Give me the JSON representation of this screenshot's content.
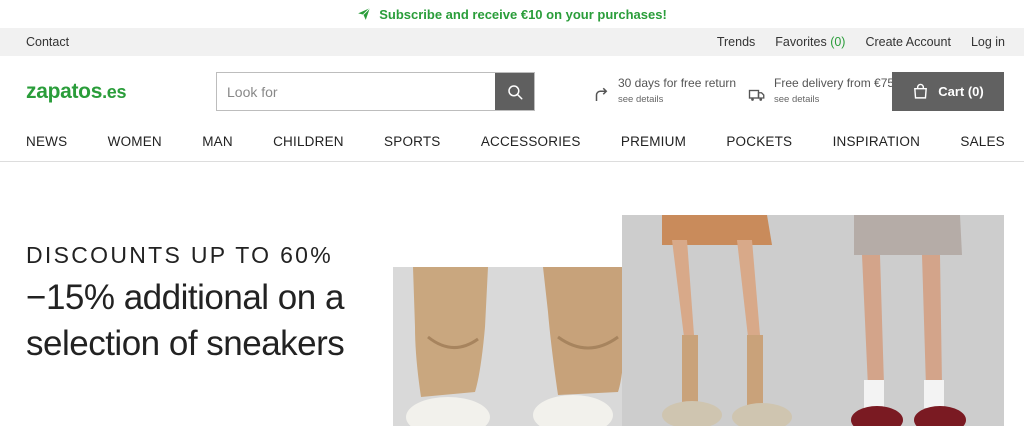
{
  "promo": {
    "text": "Subscribe and receive €10 on your purchases!",
    "icon": "paper-plane-icon"
  },
  "utility": {
    "contact": "Contact",
    "trends": "Trends",
    "favorites_label": "Favorites",
    "favorites_count": "(0)",
    "create_account": "Create Account",
    "login": "Log in"
  },
  "header": {
    "logo_main": "zapatos",
    "logo_tld": ".es",
    "search_placeholder": "Look for",
    "returns_title": "30 days for free return",
    "returns_link": "see details",
    "delivery_title": "Free delivery from €75",
    "delivery_link": "see details",
    "cart_label": "Cart (0)"
  },
  "nav": [
    "NEWS",
    "WOMEN",
    "MAN",
    "CHILDREN",
    "SPORTS",
    "ACCESSORIES",
    "PREMIUM",
    "POCKETS",
    "INSPIRATION",
    "SALES"
  ],
  "hero": {
    "eyebrow": "DISCOUNTS UP TO 60%",
    "headline": "−15% additional on a selection of sneakers"
  },
  "colors": {
    "brand_green": "#2a9d3a",
    "utility_bg": "#f1f1f1",
    "button_gray": "#616161"
  }
}
